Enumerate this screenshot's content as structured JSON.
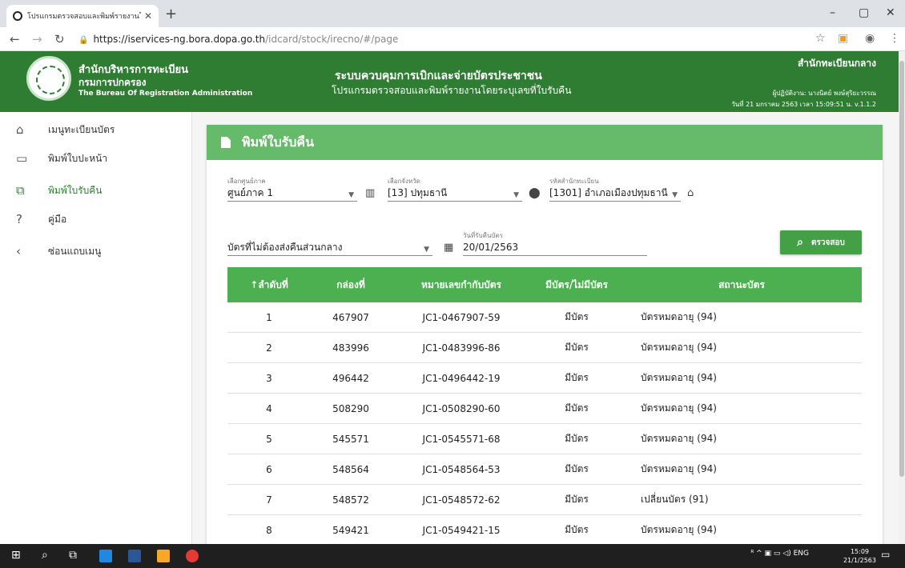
{
  "browser": {
    "tab_title": "โปรแกรมตรวจสอบและพิมพ์รายงานโดย",
    "url_host": "https://iservices-ng.bora.dopa.go.th",
    "url_path": "/idcard/stock/irecno/#/page"
  },
  "header": {
    "org_name_1": "สำนักบริหารการทะเบียน",
    "org_name_2": "กรมการปกครอง",
    "org_name_en": "The Bureau Of Registration Administration",
    "system_title": "ระบบควบคุมการเบิกและจ่ายบัตรประชาชน",
    "system_subtitle": "โปรแกรมตรวจสอบและพิมพ์รายงานโดยระบุเลขที่ใบรับคืน",
    "office": "สำนักทะเบียนกลาง",
    "operator": "ผู้ปฏิบัติงาน: นางนิตย์ พงษ์สุริยะวรรณ",
    "date_version": "วันที่ 21 มกราคม 2563 เวลา 15:09:51 น.  v.1.1.2"
  },
  "sidebar": {
    "items": [
      {
        "label": "เมนูทะเบียนบัตร",
        "icon": "home-icon"
      },
      {
        "label": "พิมพ์ใบปะหน้า",
        "icon": "card-icon"
      },
      {
        "label": "พิมพ์ใบรับคืน",
        "icon": "cards-stack-icon",
        "active": true
      },
      {
        "label": "คู่มือ",
        "icon": "help-icon"
      },
      {
        "label": "ซ่อนแถบเมนู",
        "icon": "chevron-left-icon"
      }
    ]
  },
  "card": {
    "title": "พิมพ์ใบรับคืน"
  },
  "filters": {
    "region": {
      "caption": "เลือกศูนย์ภาค",
      "value": "ศูนย์ภาค 1"
    },
    "province": {
      "caption": "เลือกจังหวัด",
      "value": "[13] ปทุมธานี"
    },
    "office": {
      "caption": "รหัสสำนักทะเบียน",
      "value": "[1301] อำเภอเมืองปทุมธานี"
    },
    "card_type": {
      "value": "บัตรที่ไม่ต้องส่งคืนส่วนกลาง"
    },
    "return_date": {
      "caption": "วันที่รับคืนบัตร",
      "value": "20/01/2563"
    },
    "check_label": "ตรวจสอบ"
  },
  "table": {
    "columns": [
      "ลำดับที่",
      "กล่องที่",
      "หมายเลขกำกับบัตร",
      "มีบัตร/ไม่มีบัตร",
      "สถานะบัตร"
    ],
    "rows": [
      [
        "1",
        "467907",
        "JC1-0467907-59",
        "มีบัตร",
        "บัตรหมดอายุ (94)"
      ],
      [
        "2",
        "483996",
        "JC1-0483996-86",
        "มีบัตร",
        "บัตรหมดอายุ (94)"
      ],
      [
        "3",
        "496442",
        "JC1-0496442-19",
        "มีบัตร",
        "บัตรหมดอายุ (94)"
      ],
      [
        "4",
        "508290",
        "JC1-0508290-60",
        "มีบัตร",
        "บัตรหมดอายุ (94)"
      ],
      [
        "5",
        "545571",
        "JC1-0545571-68",
        "มีบัตร",
        "บัตรหมดอายุ (94)"
      ],
      [
        "6",
        "548564",
        "JC1-0548564-53",
        "มีบัตร",
        "บัตรหมดอายุ (94)"
      ],
      [
        "7",
        "548572",
        "JC1-0548572-62",
        "มีบัตร",
        "เปลี่ยนบัตร (91)"
      ],
      [
        "8",
        "549421",
        "JC1-0549421-15",
        "มีบัตร",
        "บัตรหมดอายุ (94)"
      ]
    ]
  },
  "taskbar": {
    "lang": "ENG",
    "time": "15:09",
    "date": "21/1/2563"
  }
}
